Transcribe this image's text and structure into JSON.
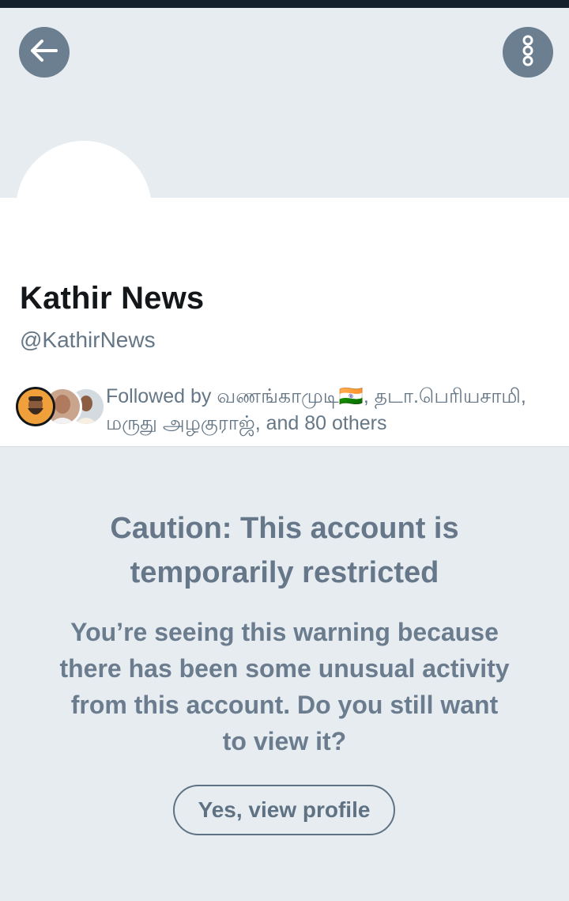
{
  "profile": {
    "name": "Kathir News",
    "handle": "@KathirNews",
    "followed_by_line1": "Followed by வணங்காமுடி🇮🇳, தடா.பெரியசாமி,",
    "followed_by_line2": "மருது அழகுராஜ், and 80 others"
  },
  "warning": {
    "title_line1": "Caution: This account is",
    "title_line2": "temporarily restricted",
    "body_line1": "You’re seeing this warning because",
    "body_line2": "there has been some unusual activity",
    "body_line3": "from this account. Do you still want",
    "body_line4": "to view it?",
    "button_label": "Yes, view profile"
  },
  "icons": {
    "back": "arrow-left-icon",
    "more": "more-vertical-icon"
  },
  "colors": {
    "background": "#e6ecf0",
    "icon_button": "#6b7f90",
    "secondary_text": "#657786"
  }
}
